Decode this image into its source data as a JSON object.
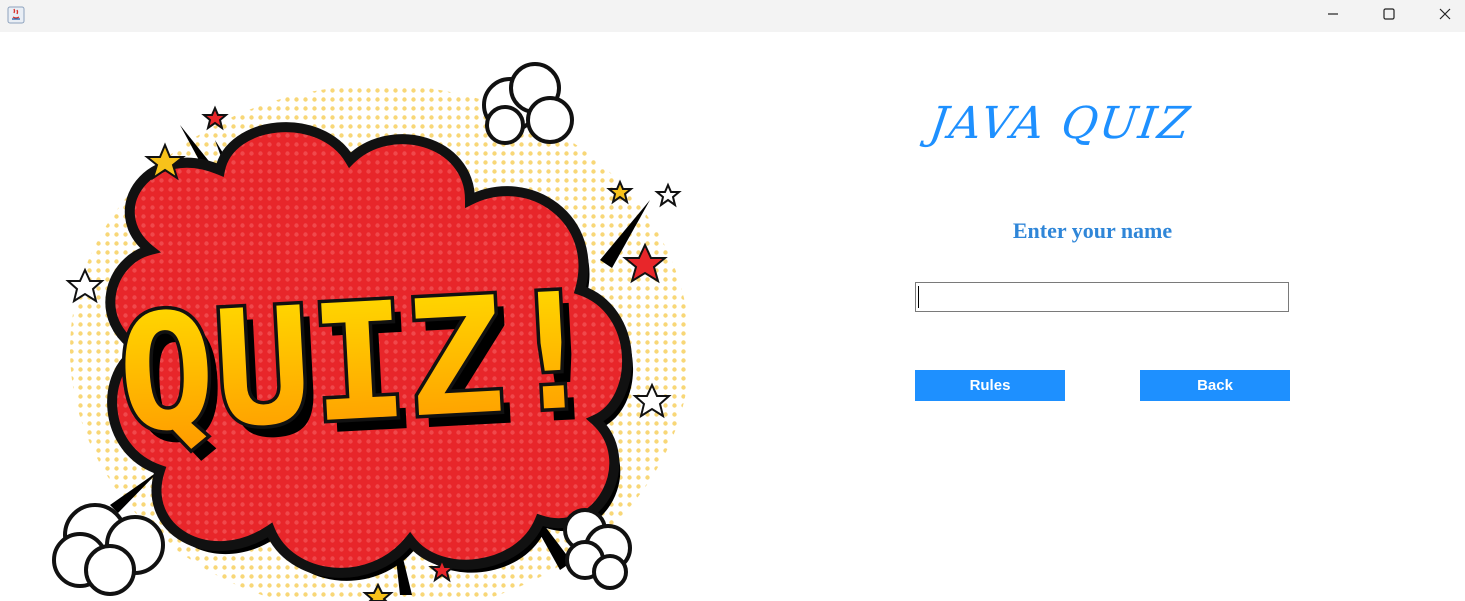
{
  "window": {
    "controls": {
      "minimize": "minimize-icon",
      "maximize": "maximize-icon",
      "close": "close-icon"
    }
  },
  "illustration": {
    "text": "QUIZ!"
  },
  "header": {
    "title": "JAVA QUIZ"
  },
  "form": {
    "prompt": "Enter your name",
    "name_value": ""
  },
  "buttons": {
    "rules": "Rules",
    "back": "Back"
  },
  "colors": {
    "accent": "#1e90ff",
    "burst_red": "#e8262a",
    "text_yellow": "#ffd000"
  }
}
